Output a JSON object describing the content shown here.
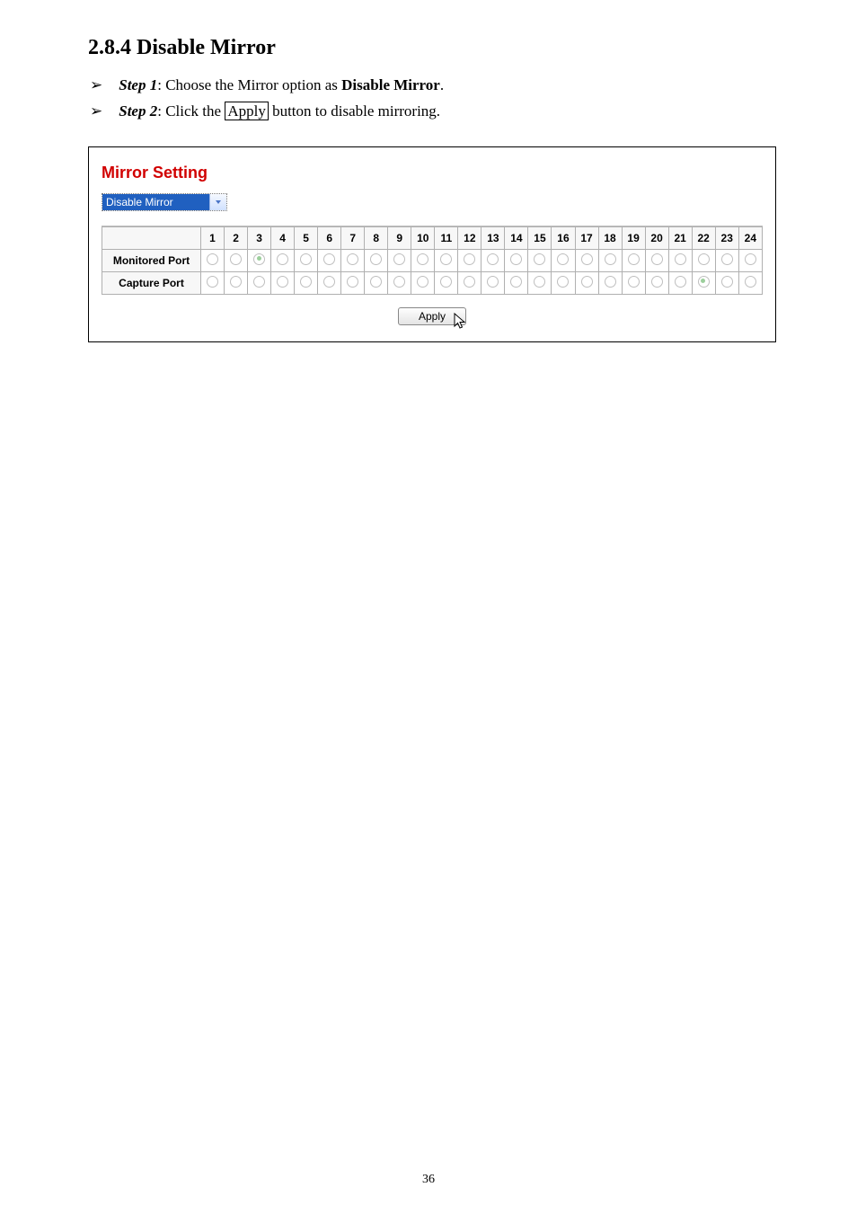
{
  "heading": "2.8.4   Disable Mirror",
  "steps": {
    "s1_label": "Step 1",
    "s1_rest1": ": Choose the Mirror option as ",
    "s1_bold": "Disable Mirror",
    "s1_rest2": ".",
    "s2_label": "Step 2",
    "s2_rest1": ": Click the ",
    "s2_button": "Apply",
    "s2_rest2": " button to disable mirroring."
  },
  "panel": {
    "title": "Mirror Setting",
    "dropdown_value": "Disable Mirror",
    "row_labels": [
      "Monitored Port",
      "Capture Port"
    ],
    "columns": [
      "1",
      "2",
      "3",
      "4",
      "5",
      "6",
      "7",
      "8",
      "9",
      "10",
      "11",
      "12",
      "13",
      "14",
      "15",
      "16",
      "17",
      "18",
      "19",
      "20",
      "21",
      "22",
      "23",
      "24"
    ],
    "monitored_selected": 3,
    "capture_selected": 22,
    "apply_label": "Apply"
  },
  "page_number": "36"
}
